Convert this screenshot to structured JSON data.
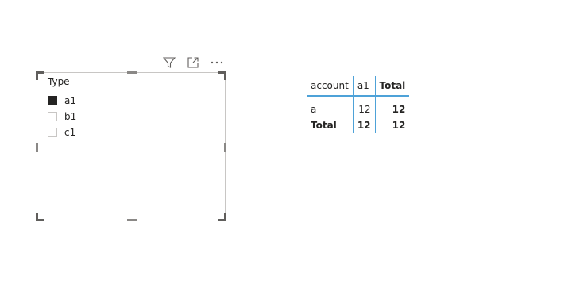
{
  "visual_header": {
    "icons": [
      "filter-icon",
      "focus-mode-icon",
      "more-options-icon"
    ]
  },
  "slicer": {
    "title": "Type",
    "items": [
      {
        "label": "a1",
        "checked": true
      },
      {
        "label": "b1",
        "checked": false
      },
      {
        "label": "c1",
        "checked": false
      }
    ]
  },
  "matrix": {
    "headers": [
      "account",
      "a1",
      "Total"
    ],
    "rows": [
      {
        "label": "a",
        "a1": "12",
        "total": "12"
      },
      {
        "label": "Total",
        "a1": "12",
        "total": "12"
      }
    ]
  },
  "colors": {
    "accent_blue": "#4ea2d8",
    "text": "#252423",
    "border": "#c8c6c4"
  }
}
